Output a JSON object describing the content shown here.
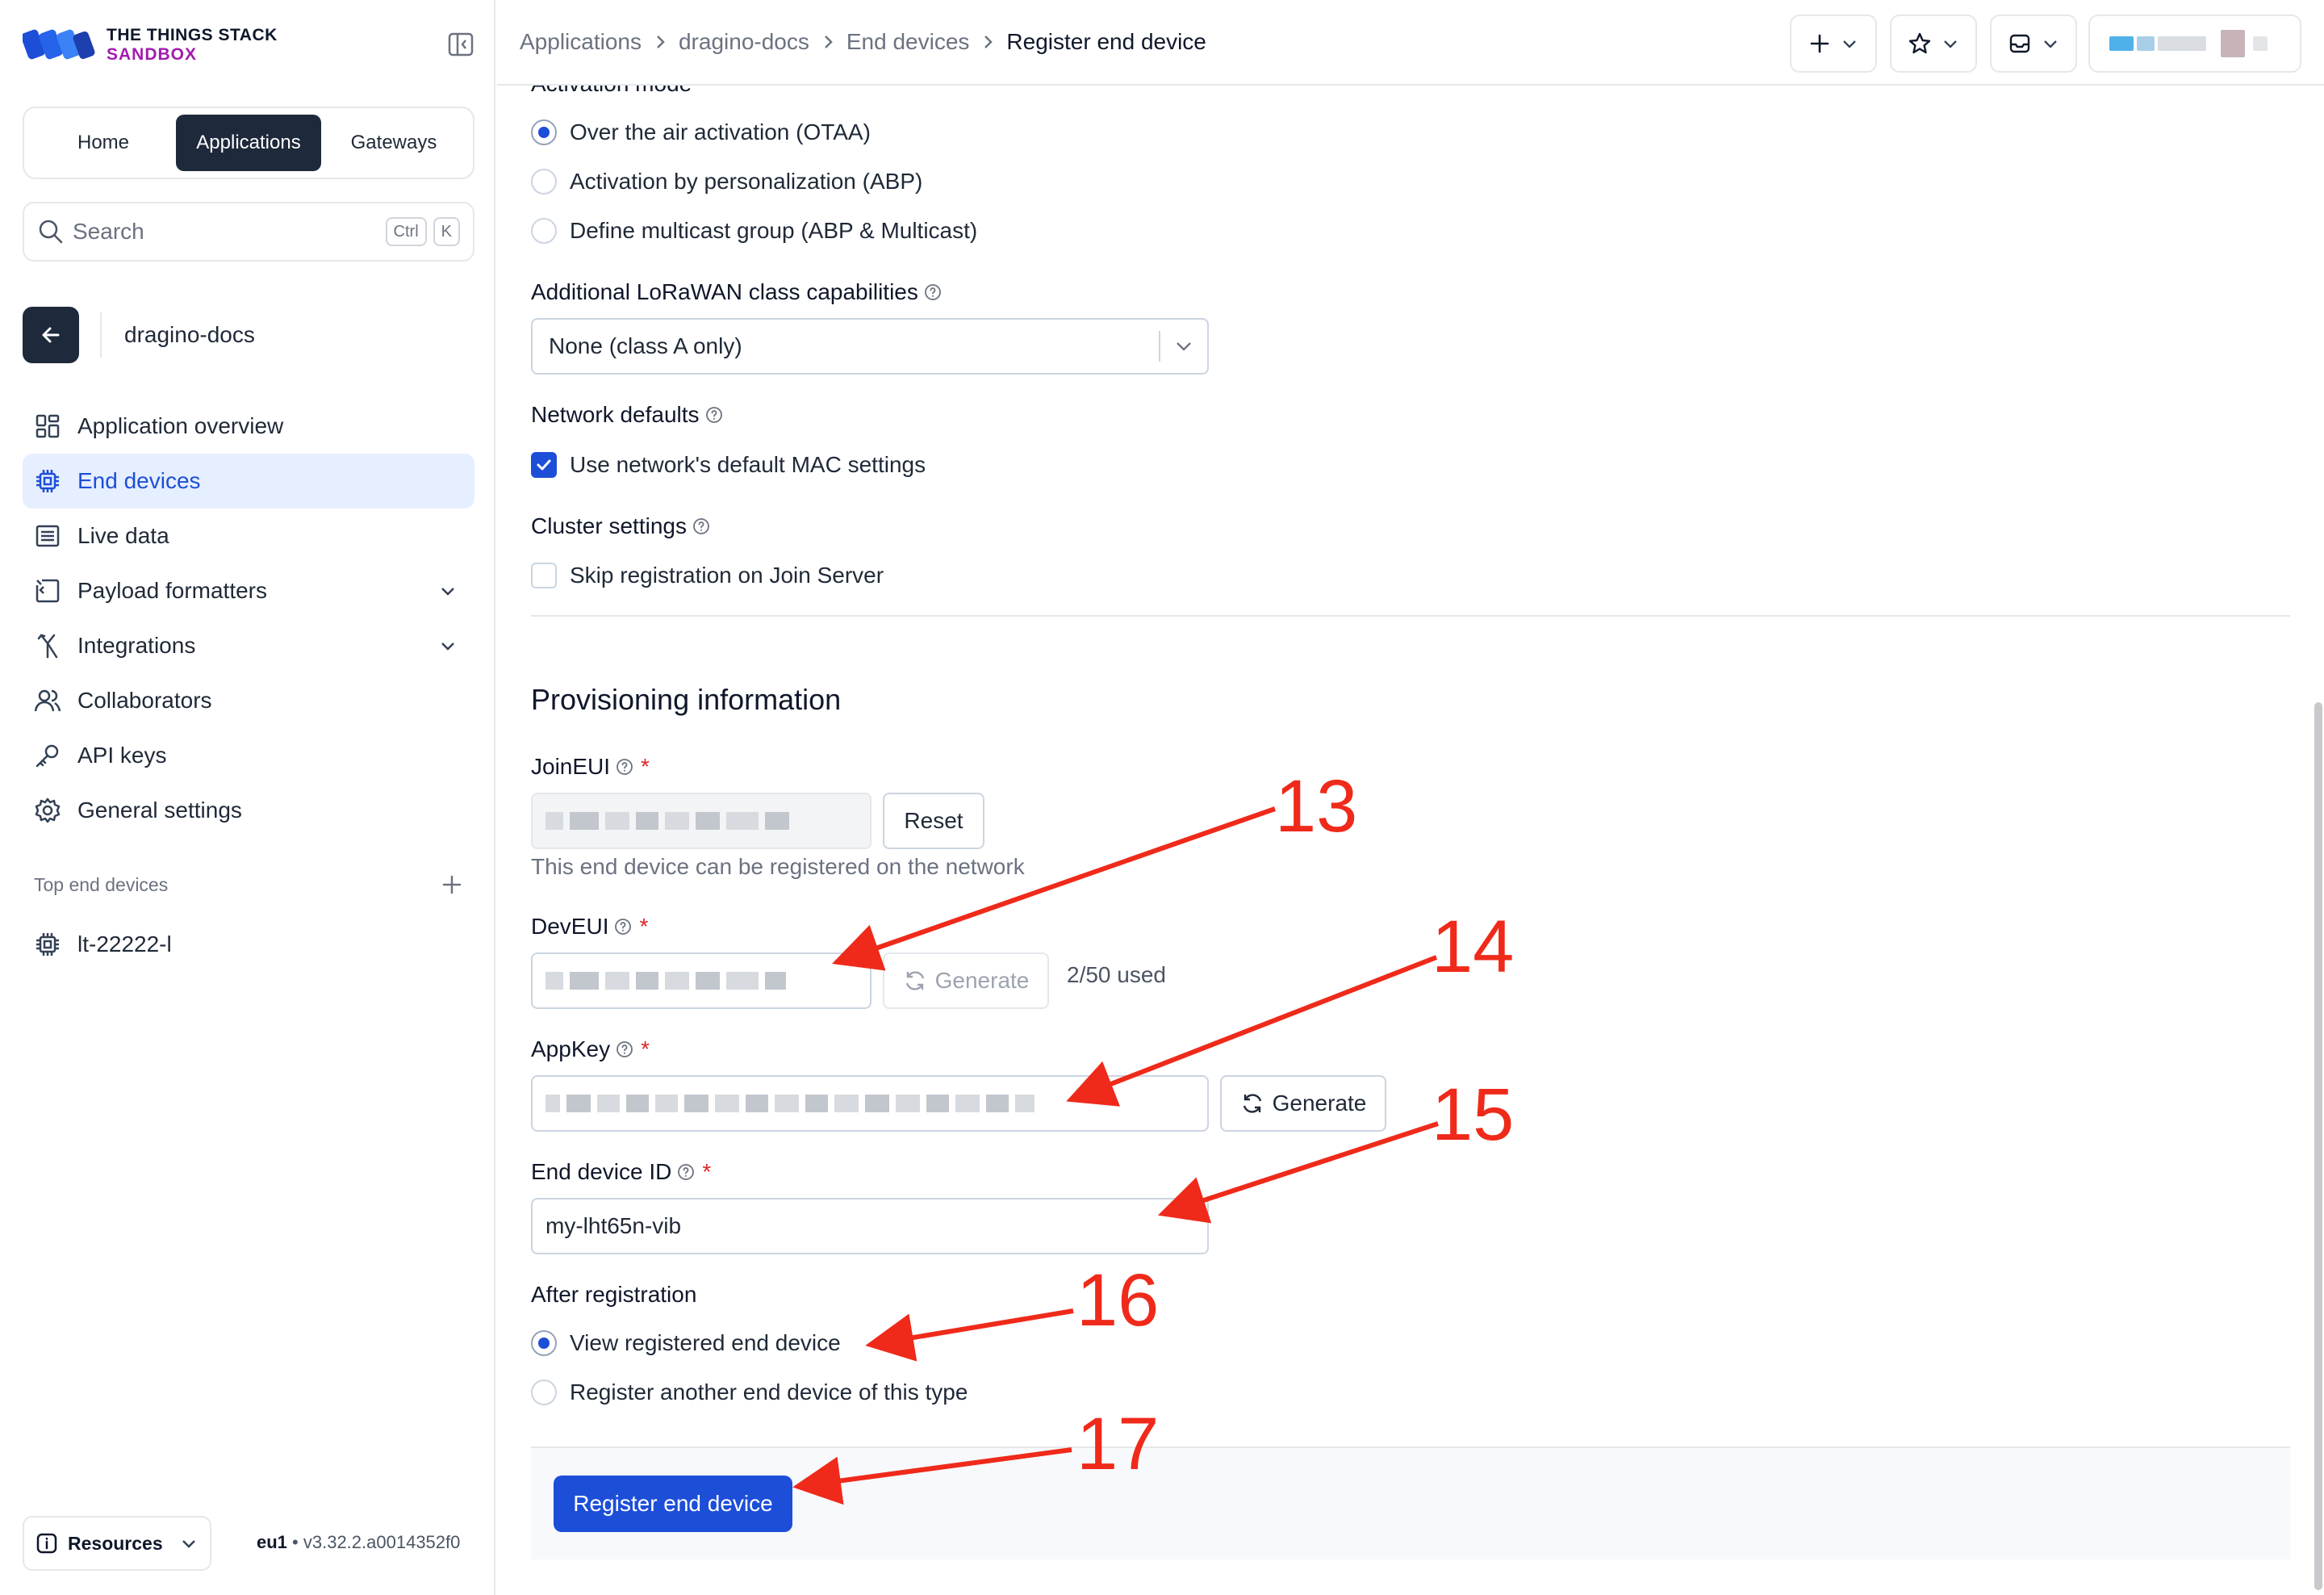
{
  "brand": {
    "line1": "THE THINGS STACK",
    "line2": "SANDBOX"
  },
  "sidebar": {
    "tabs": [
      {
        "label": "Home",
        "active": false
      },
      {
        "label": "Applications",
        "active": true
      },
      {
        "label": "Gateways",
        "active": false
      }
    ],
    "search": {
      "placeholder": "Search",
      "kbd1": "Ctrl",
      "kbd2": "K"
    },
    "app_name": "dragino-docs",
    "nav": [
      {
        "label": "Application overview",
        "icon": "grid-icon",
        "active": false
      },
      {
        "label": "End devices",
        "icon": "chip-icon",
        "active": true
      },
      {
        "label": "Live data",
        "icon": "list-icon",
        "active": false
      },
      {
        "label": "Payload formatters",
        "icon": "code-icon",
        "active": false,
        "expandable": true
      },
      {
        "label": "Integrations",
        "icon": "fork-icon",
        "active": false,
        "expandable": true
      },
      {
        "label": "Collaborators",
        "icon": "users-icon",
        "active": false
      },
      {
        "label": "API keys",
        "icon": "key-icon",
        "active": false
      },
      {
        "label": "General settings",
        "icon": "gear-icon",
        "active": false
      }
    ],
    "top_devices_label": "Top end devices",
    "top_devices": [
      {
        "label": "lt-22222-l"
      }
    ],
    "resources_label": "Resources",
    "version_region": "eu1",
    "version_text": "• v3.32.2.a0014352f0"
  },
  "header": {
    "breadcrumbs": [
      "Applications",
      "dragino-docs",
      "End devices",
      "Register end device"
    ]
  },
  "form": {
    "activation_mode_label": "Activation mode",
    "activation_options": [
      {
        "label": "Over the air activation (OTAA)",
        "selected": true
      },
      {
        "label": "Activation by personalization (ABP)",
        "selected": false
      },
      {
        "label": "Define multicast group (ABP & Multicast)",
        "selected": false
      }
    ],
    "class_label": "Additional LoRaWAN class capabilities",
    "class_value": "None (class A only)",
    "network_defaults_label": "Network defaults",
    "network_defaults_checkbox": "Use network's default MAC settings",
    "network_defaults_checked": true,
    "cluster_label": "Cluster settings",
    "cluster_checkbox": "Skip registration on Join Server",
    "cluster_checked": false,
    "provisioning_title": "Provisioning information",
    "join_eui_label": "JoinEUI",
    "reset_label": "Reset",
    "join_eui_hint": "This end device can be registered on the network",
    "dev_eui_label": "DevEUI",
    "generate_label": "Generate",
    "dev_eui_usage": "2/50 used",
    "app_key_label": "AppKey",
    "end_device_id_label": "End device ID",
    "end_device_id_value": "my-lht65n-vib",
    "after_registration_label": "After registration",
    "after_options": [
      {
        "label": "View registered end device",
        "selected": true
      },
      {
        "label": "Register another end device of this type",
        "selected": false
      }
    ],
    "submit_label": "Register end device",
    "required_mark": "*"
  },
  "annotations": [
    "13",
    "14",
    "15",
    "16",
    "17"
  ],
  "colors": {
    "accent": "#1d4ed8",
    "annotation": "#ef2a1a",
    "brand_purple": "#a21caf",
    "dark": "#1e293b"
  }
}
